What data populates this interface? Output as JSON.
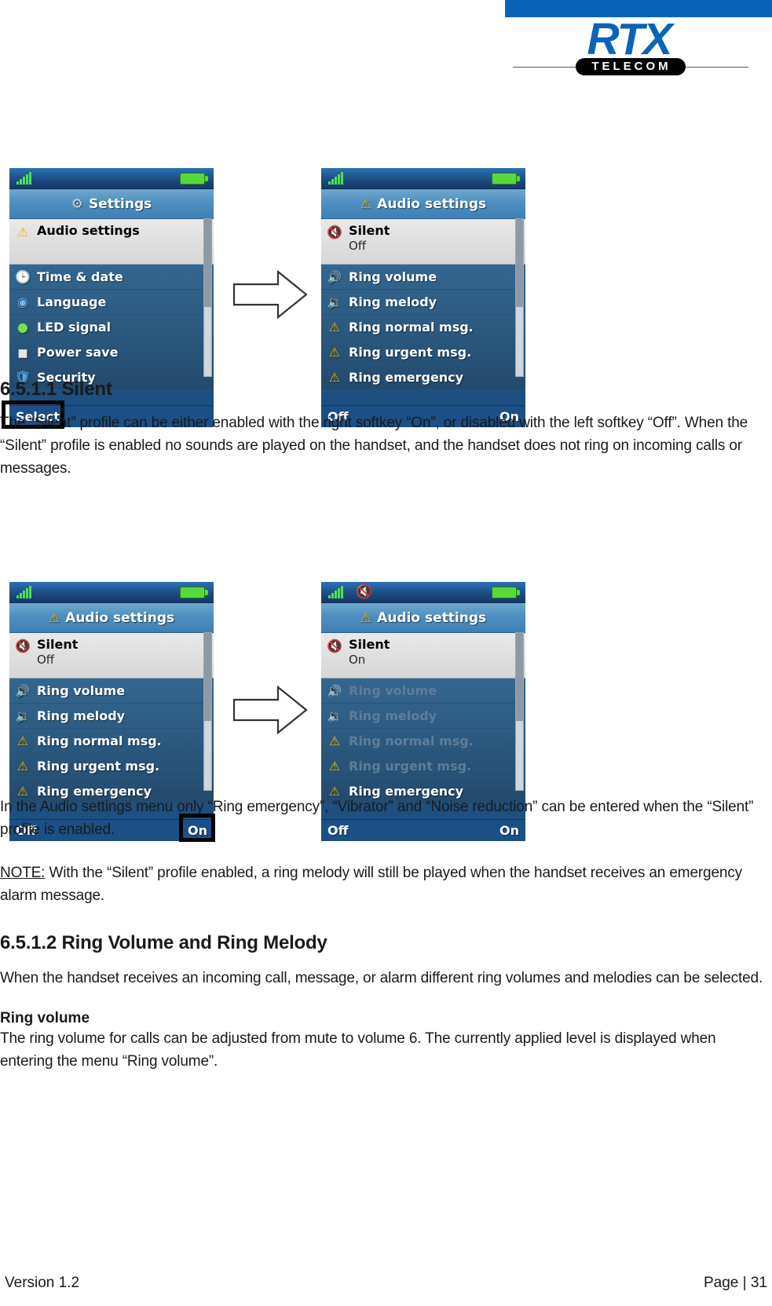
{
  "brand": {
    "logo_main": "RTX",
    "logo_sub": "TELECOM"
  },
  "screens": [
    {
      "id": "settings",
      "title": "Settings",
      "title_icon": "gear-icon",
      "status": {
        "signal": "signal-bars-icon",
        "battery": "battery-icon",
        "silent": null
      },
      "selected": {
        "label": "Audio settings",
        "value": "",
        "icon": "ring-alert-icon"
      },
      "items": [
        {
          "label": "Time & date",
          "icon": "clock-icon",
          "dim": false
        },
        {
          "label": "Language",
          "icon": "globe-icon",
          "dim": false
        },
        {
          "label": "LED signal",
          "icon": "led-icon",
          "dim": false
        },
        {
          "label": "Power save",
          "icon": "power-save-icon",
          "dim": false
        },
        {
          "label": "Security",
          "icon": "shield-icon",
          "dim": false
        }
      ],
      "softkeys": {
        "left": "Select",
        "right": "",
        "highlight": "left"
      }
    },
    {
      "id": "audio-settings-off",
      "title": "Audio settings",
      "title_icon": "ring-alert-icon",
      "status": {
        "signal": "signal-bars-icon",
        "battery": "battery-icon",
        "silent": null
      },
      "selected": {
        "label": "Silent",
        "value": "Off",
        "icon": "mute-icon"
      },
      "items": [
        {
          "label": "Ring volume",
          "icon": "speaker-volume-icon",
          "dim": false
        },
        {
          "label": "Ring melody",
          "icon": "speaker-melody-icon",
          "dim": false
        },
        {
          "label": "Ring normal msg.",
          "icon": "ring-alert-icon",
          "dim": false
        },
        {
          "label": "Ring urgent msg.",
          "icon": "ring-alert-icon",
          "dim": false
        },
        {
          "label": "Ring emergency",
          "icon": "ring-alert-icon",
          "dim": false
        }
      ],
      "softkeys": {
        "left": "Off",
        "right": "On",
        "highlight": "none"
      }
    },
    {
      "id": "audio-settings-off-pressing-on",
      "title": "Audio settings",
      "title_icon": "ring-alert-icon",
      "status": {
        "signal": "signal-bars-icon",
        "battery": "battery-icon",
        "silent": null
      },
      "selected": {
        "label": "Silent",
        "value": "Off",
        "icon": "mute-icon"
      },
      "items": [
        {
          "label": "Ring volume",
          "icon": "speaker-volume-icon",
          "dim": false
        },
        {
          "label": "Ring melody",
          "icon": "speaker-melody-icon",
          "dim": false
        },
        {
          "label": "Ring normal msg.",
          "icon": "ring-alert-icon",
          "dim": false
        },
        {
          "label": "Ring urgent msg.",
          "icon": "ring-alert-icon",
          "dim": false
        },
        {
          "label": "Ring emergency",
          "icon": "ring-alert-icon",
          "dim": false
        }
      ],
      "softkeys": {
        "left": "Off",
        "right": "On",
        "highlight": "right"
      }
    },
    {
      "id": "audio-settings-on",
      "title": "Audio settings",
      "title_icon": "ring-alert-icon",
      "status": {
        "signal": "signal-bars-icon",
        "battery": "battery-icon",
        "silent": "mute-icon"
      },
      "selected": {
        "label": "Silent",
        "value": "On",
        "icon": "mute-icon"
      },
      "items": [
        {
          "label": "Ring volume",
          "icon": "speaker-volume-icon",
          "dim": true
        },
        {
          "label": "Ring melody",
          "icon": "speaker-melody-icon",
          "dim": true
        },
        {
          "label": "Ring normal msg.",
          "icon": "ring-alert-icon",
          "dim": true
        },
        {
          "label": "Ring urgent msg.",
          "icon": "ring-alert-icon",
          "dim": true
        },
        {
          "label": "Ring emergency",
          "icon": "ring-alert-icon",
          "dim": false
        }
      ],
      "softkeys": {
        "left": "Off",
        "right": "On",
        "highlight": "none"
      }
    }
  ],
  "doc": {
    "heading_1": "6.5.1.1 Silent",
    "para_1": "The “Silent” profile can be either enabled with the right softkey “On”, or disabled with the left softkey “Off”. When the “Silent” profile is enabled no sounds are played on the handset, and the handset does not ring on incoming calls or messages.",
    "para_2": "In the Audio settings menu only “Ring emergency”, “Vibrator” and “Noise reduction” can be entered when the “Silent” profile is enabled.",
    "note_label": "NOTE:",
    "note_text": " With the “Silent” profile enabled, a ring melody will still be played when the handset receives an emergency alarm message.",
    "heading_2": "6.5.1.2 Ring Volume and Ring Melody",
    "para_3": "When the handset receives an incoming call, message, or alarm different ring volumes and melodies can be selected.",
    "subhead_1": "Ring volume",
    "para_4": "The ring volume for calls can be adjusted from mute to volume 6. The currently applied level is displayed when entering the menu “Ring volume”."
  },
  "footer": {
    "version": "Version 1.2",
    "page": "Page | 31"
  }
}
